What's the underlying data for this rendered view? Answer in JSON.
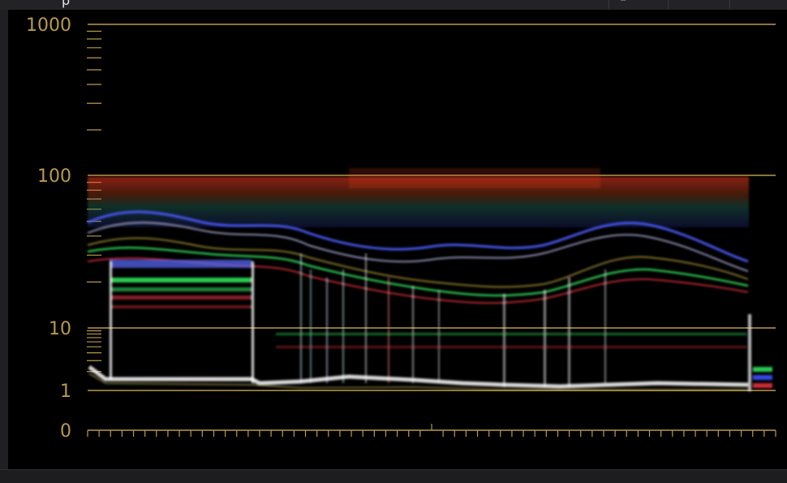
{
  "title_fragment": "p",
  "tab_glyph": "─°",
  "scope": {
    "scale": "logarithmic (nits)",
    "y_tick_labels": [
      "1000",
      "100",
      "10",
      "1",
      "0"
    ],
    "y_tick_values": [
      1000,
      100,
      10,
      1,
      0
    ],
    "reference_lines": [
      1000,
      100,
      10,
      1
    ],
    "colors": {
      "axis": "#b89a4a",
      "red_trace": "#e0303c",
      "green_trace": "#2ee05a",
      "blue_trace": "#3c50ff",
      "white_trace": "#f0f0f0"
    }
  },
  "chart_data": {
    "type": "area",
    "y_scale": "log",
    "ylim": [
      0,
      1000
    ],
    "yticks": [
      0,
      1,
      10,
      100,
      1000
    ],
    "grid": true,
    "series": [
      {
        "values_range": "dense waveform, 1 to 100 nits",
        "color": "#ffffff"
      }
    ]
  }
}
